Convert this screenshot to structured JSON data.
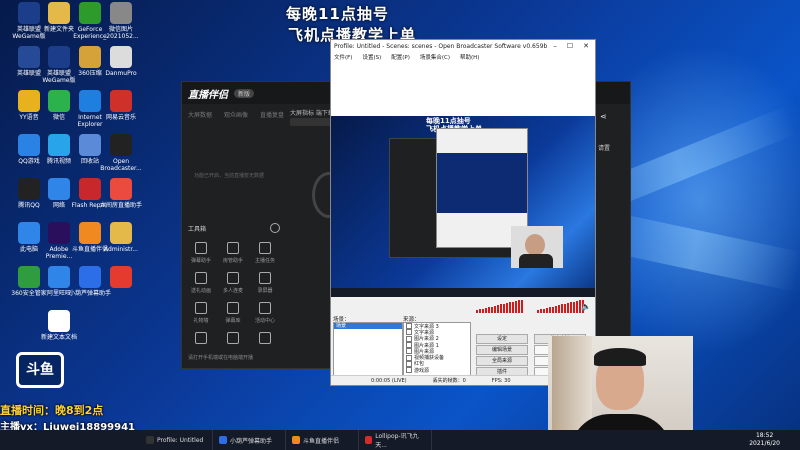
{
  "overlay": {
    "line1": "每晚11点抽号",
    "line2": "飞机点播教学上单"
  },
  "desktop_icons": [
    {
      "label": "英雄联盟WeGame版",
      "color": "#1b3d8a"
    },
    {
      "label": "新建文件夹",
      "color": "#e5b84a"
    },
    {
      "label": "GeForce Experience",
      "color": "#2c9b2c"
    },
    {
      "label": "微信图片_2021052...",
      "color": "#888888"
    },
    {
      "label": "英雄联盟",
      "color": "#264a96"
    },
    {
      "label": "英雄联盟WeGame版",
      "color": "#1b3d8a"
    },
    {
      "label": "360压缩",
      "color": "#d5a23a"
    },
    {
      "label": "DanmuPro",
      "color": "#dcdcdc"
    },
    {
      "label": "YY语音",
      "color": "#e7b21e"
    },
    {
      "label": "微信",
      "color": "#2bb24c"
    },
    {
      "label": "Internet Explorer",
      "color": "#1f7fe0"
    },
    {
      "label": "网易云音乐",
      "color": "#d0302a"
    },
    {
      "label": "QQ游戏",
      "color": "#2a82e4"
    },
    {
      "label": "腾讯视频",
      "color": "#27a4ea"
    },
    {
      "label": "回收站",
      "color": "#5b8bd8"
    },
    {
      "label": "Open Broadcaster...",
      "color": "#222222"
    },
    {
      "label": "腾讯QQ",
      "color": "#222222"
    },
    {
      "label": "网络",
      "color": "#2f86e8"
    },
    {
      "label": "Flash Repair",
      "color": "#c8282b"
    },
    {
      "label": "六间房直播助手",
      "color": "#ea4b3e"
    },
    {
      "label": "此电脑",
      "color": "#2f86e8"
    },
    {
      "label": "Adobe Premie...",
      "color": "#2a0f5c"
    },
    {
      "label": "斗鱼直播伴侣",
      "color": "#f08a20"
    },
    {
      "label": "Administr...",
      "color": "#e5b84a"
    },
    {
      "label": "360安全管家",
      "color": "#2f9c3f"
    },
    {
      "label": "阿里旺旺",
      "color": "#2f86e8"
    },
    {
      "label": "小葫芦弹幕助手",
      "color": "#2b6ee8"
    },
    {
      "label": "",
      "color": "#e53a2e"
    },
    {
      "label": "",
      "color": "#f0c020"
    },
    {
      "label": "新建文本文档",
      "color": "#ffffff"
    }
  ],
  "assistant": {
    "logo": "直播伴侣",
    "version": "新版",
    "menu": [
      "大屏数据",
      "观众画像",
      "直播复盘"
    ],
    "header_text": "大屏指标  端下载",
    "empty_hint": "功能已开启，当前直播暂无数据",
    "tools_title": "工具箱",
    "tools": [
      "弹幕助手",
      "房管助手",
      "主播任务",
      "送礼动画",
      "多人连麦",
      "录屏器",
      "礼物墙",
      "弹幕库",
      "活动中心",
      "",
      "",
      ""
    ],
    "footer": "请打开手机端或在电脑端开播"
  },
  "obs": {
    "title": "Profile: Untitled - Scenes: scenes - Open Broadcaster Software v0.659b",
    "menu": [
      "文件(F)",
      "设置(S)",
      "配置(P)",
      "场景集合(C)",
      "帮助(H)"
    ],
    "preview_text1": "每晚11点抽号",
    "preview_text2": "飞机点播教学上单",
    "scenes_label": "场景：",
    "sources_label": "来源：",
    "scenes": [
      "场景"
    ],
    "sources": [
      "文字来源 3",
      "文字来源",
      "图片来源 2",
      "图片来源 1",
      "图片来源",
      "视频捕获设备",
      "红包",
      "游戏源"
    ],
    "buttons": [
      "设定",
      "停止串流",
      "编辑场景",
      "全局来源",
      "插件"
    ],
    "status": {
      "time": "0:00:05 (LIVE)",
      "dropped": "丢失的帧数：0",
      "fps": "FPS: 30"
    }
  },
  "assistant_right_tab": "请置",
  "ad_overlay": {
    "line1": "直播时间：晚8到2点",
    "line2": "主播vx：Liuwei18899941",
    "prefix1": "主",
    "prefix2": "vx"
  },
  "taskbar": [
    {
      "label": "Profile: Untitled",
      "color": "#333333"
    },
    {
      "label": "小葫芦弹幕助手",
      "color": "#2b6ee8"
    },
    {
      "label": "斗鱼直播伴侣",
      "color": "#f08a20"
    },
    {
      "label": "Lollipop-讯飞九天...",
      "color": "#d32a2a"
    }
  ],
  "clock": {
    "time": "18:52",
    "date": "2021/6/20"
  }
}
